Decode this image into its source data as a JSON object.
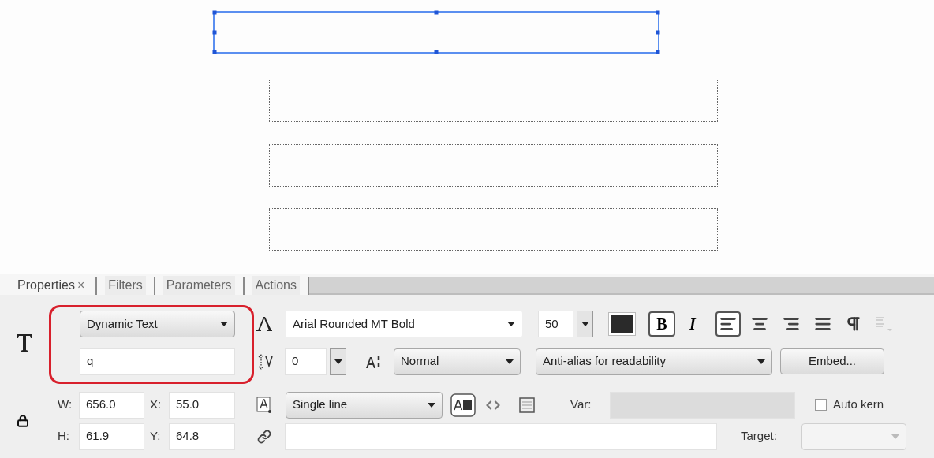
{
  "stage": {
    "text_boxes": [
      {
        "selected": true
      },
      {
        "selected": false
      },
      {
        "selected": false
      },
      {
        "selected": false
      }
    ]
  },
  "tabs": [
    {
      "label": "Properties",
      "close": "×",
      "selected": true
    },
    {
      "label": "Filters",
      "selected": false
    },
    {
      "label": "Parameters",
      "selected": false
    },
    {
      "label": "Actions",
      "selected": false
    }
  ],
  "text_type": "Dynamic Text",
  "instance_name": "q",
  "font": "Arial Rounded MT Bold",
  "font_size": "50",
  "style_buttons": [
    {
      "label": "B",
      "on": true,
      "kind": "bold"
    },
    {
      "label": "I",
      "on": false,
      "kind": "italic"
    }
  ],
  "align_buttons": [
    {
      "kind": "left",
      "selected": true
    },
    {
      "kind": "center",
      "selected": false
    },
    {
      "kind": "right",
      "selected": false
    },
    {
      "kind": "justify",
      "selected": false
    }
  ],
  "letter_spacing": "0",
  "char_position": "Normal",
  "anti_alias": "Anti-alias for readability",
  "embed_button": "Embed...",
  "width": {
    "label": "W:",
    "value": "656.0"
  },
  "x": {
    "label": "X:",
    "value": "55.0"
  },
  "height": {
    "label": "H:",
    "value": "61.9"
  },
  "y": {
    "label": "Y:",
    "value": "64.8"
  },
  "line_type": "Single line",
  "var": {
    "label": "Var:",
    "disabled": true
  },
  "auto_kern": {
    "label": "Auto kern",
    "checked": false
  },
  "target": {
    "label": "Target:",
    "disabled": true
  }
}
